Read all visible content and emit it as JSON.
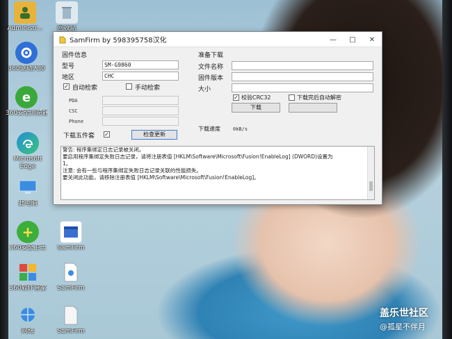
{
  "desktop": {
    "icons": [
      {
        "label": "Administr...",
        "icon": "user-folder-icon",
        "color": "#e8b33a"
      },
      {
        "label": "回收站",
        "icon": "recycle-bin-icon",
        "color": "#dfe9f0"
      },
      {
        "label": "360驱动大师",
        "icon": "driver-master-icon",
        "color": "#2f6fd6"
      },
      {
        "label": "360安全浏览器",
        "icon": "browser-icon",
        "color": "#3aa83a"
      },
      {
        "label": "Microsoft Edge",
        "icon": "edge-icon",
        "color": "#1f8fd8"
      },
      {
        "label": "此电脑",
        "icon": "computer-icon",
        "color": "#3a8de0"
      },
      {
        "label": "360安全卫士",
        "icon": "security-guard-icon",
        "color": "#3cae3c"
      },
      {
        "label": "SamFirm",
        "icon": "samfirm-icon",
        "color": "#3a6fd0"
      },
      {
        "label": "360软件管家",
        "icon": "software-manager-icon",
        "color": "#e04a3a"
      },
      {
        "label": "SamFirm",
        "icon": "file-icon",
        "color": "#ffffff"
      },
      {
        "label": "网络",
        "icon": "network-icon",
        "color": "#3a8de0"
      },
      {
        "label": "SamFirm",
        "icon": "file-icon",
        "color": "#ffffff"
      }
    ]
  },
  "window": {
    "title": "SamFirm by 598395758汉化",
    "controls": {
      "minimize": "—",
      "maximize": "□",
      "close": "✕"
    },
    "left": {
      "section_title": "固件信息",
      "model_label": "型号",
      "model_value": "SM-G9860",
      "region_label": "地区",
      "region_value": "CHC",
      "auto_check_label": "自动检索",
      "auto_check_checked": true,
      "manual_check_label": "手动检索",
      "manual_check_checked": false,
      "pda_label": "PDA",
      "csc_label": "CSC",
      "phone_label": "Phone",
      "download_fw_label": "下载五件套",
      "download_fw_checked": true,
      "check_update_button": "检查更新"
    },
    "right": {
      "section_title": "准备下载",
      "filename_label": "文件名称",
      "version_label": "固件版本",
      "size_label": "大小",
      "crc_label": "校验CRC32",
      "crc_checked": true,
      "auto_decrypt_label": "下载完后自动解密",
      "auto_decrypt_checked": false,
      "download_button": "下载",
      "speed_label": "下载速度",
      "speed_value": "0kB/s"
    },
    "log_lines": [
      "警告: 程序集绑定日志记录被关闭。",
      "要启用程序集绑定失败日志记录，请将注册表值 [HKLM\\Software\\Microsoft\\Fusion!EnableLog] (DWORD)设置为",
      "1。",
      "注意: 会有一些与程序集绑定失败日志记录关联的性能损失。",
      "要关闭此功能，请移除注册表值 [HKLM\\Software\\Microsoft\\Fusion!EnableLog]。"
    ]
  },
  "watermark": {
    "line1": "盖乐世社区",
    "line2": "@孤星不伴月"
  }
}
